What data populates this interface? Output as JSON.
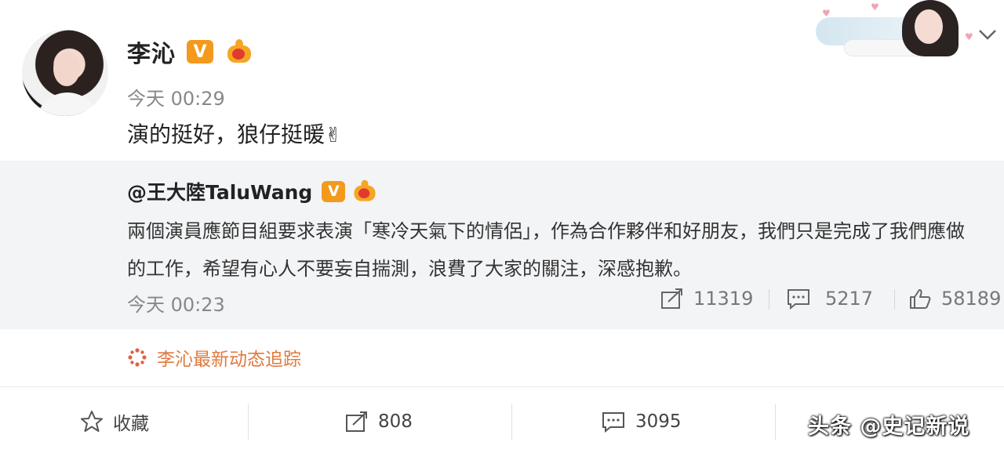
{
  "post": {
    "author": "李沁",
    "time": "今天 00:29",
    "text": "演的挺好，狼仔挺暖",
    "emoji": "✌"
  },
  "repost": {
    "author": "@王大陸TaluWang",
    "text": "兩個演員應節目組要求表演「寒冷天氣下的情侶」，作為合作夥伴和好朋友，我們只是完成了我們應做的工作，希望有心人不要妄自揣測，浪費了大家的關注，深感抱歉。",
    "time": "今天 00:23",
    "stats": {
      "reposts": "11319",
      "comments": "5217",
      "likes": "58189"
    }
  },
  "track": {
    "label": "李沁最新动态追踪"
  },
  "actions": {
    "favorite": "收藏",
    "reposts": "808",
    "comments": "3095"
  },
  "badges": {
    "verified": "V"
  },
  "watermark": "头条 @史记新说",
  "colors": {
    "verified_badge": "#f39a1c",
    "track_text": "#e07a3f",
    "repost_bg": "#f3f4f6"
  }
}
